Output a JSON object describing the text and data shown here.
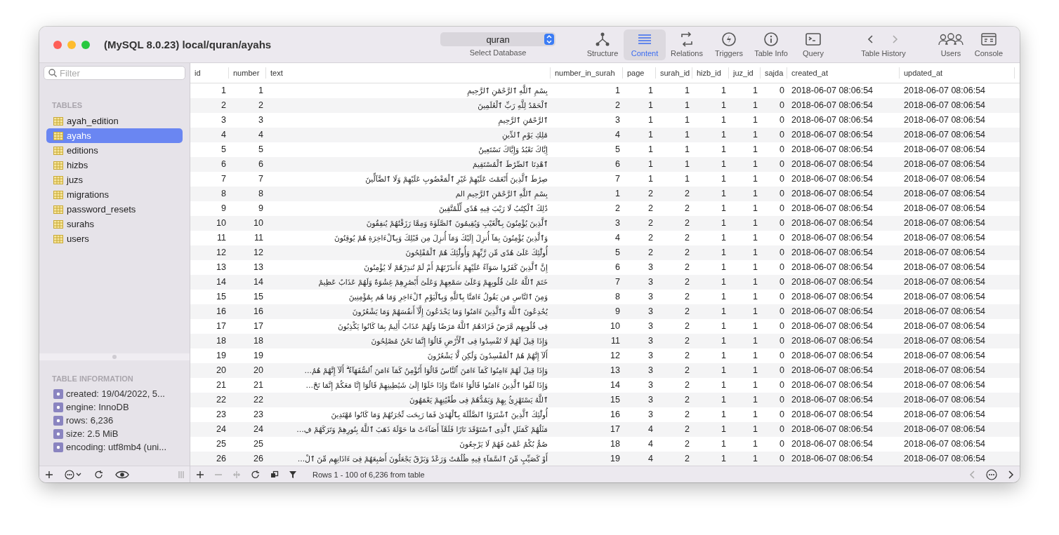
{
  "window": {
    "title": "(MySQL 8.0.23) local/quran/ayahs"
  },
  "database_selector": {
    "value": "quran",
    "label": "Select Database"
  },
  "toolbar": [
    {
      "kind": "structure",
      "label": "Structure",
      "selected": false
    },
    {
      "kind": "content",
      "label": "Content",
      "selected": true
    },
    {
      "kind": "relations",
      "label": "Relations",
      "selected": false
    },
    {
      "kind": "triggers",
      "label": "Triggers",
      "selected": false
    },
    {
      "kind": "info",
      "label": "Table Info",
      "selected": false
    },
    {
      "kind": "query",
      "label": "Query",
      "selected": false
    },
    {
      "kind": "history",
      "label": "Table History",
      "selected": false
    },
    {
      "kind": "users",
      "label": "Users",
      "selected": false
    },
    {
      "kind": "console",
      "label": "Console",
      "selected": false
    }
  ],
  "sidebar": {
    "filter_placeholder": "Filter",
    "tables_heading": "TABLES",
    "tables": [
      {
        "name": "ayah_edition",
        "selected": false
      },
      {
        "name": "ayahs",
        "selected": true
      },
      {
        "name": "editions",
        "selected": false
      },
      {
        "name": "hizbs",
        "selected": false
      },
      {
        "name": "juzs",
        "selected": false
      },
      {
        "name": "migrations",
        "selected": false
      },
      {
        "name": "password_resets",
        "selected": false
      },
      {
        "name": "surahs",
        "selected": false
      },
      {
        "name": "users",
        "selected": false
      }
    ],
    "info_heading": "TABLE INFORMATION",
    "info": [
      "created: 19/04/2022, 5...",
      "engine: InnoDB",
      "rows: 6,236",
      "size: 2.5 MiB",
      "encoding: utf8mb4 (uni..."
    ]
  },
  "table": {
    "columns": [
      "id",
      "number",
      "text",
      "number_in_surah",
      "page",
      "surah_id",
      "hizb_id",
      "juz_id",
      "sajda",
      "created_at",
      "updated_at"
    ],
    "rows": [
      [
        "1",
        "1",
        "بِسْمِ ٱللَّهِ ٱلرَّحْمَٰنِ ٱلرَّحِيمِ",
        "1",
        "1",
        "1",
        "1",
        "1",
        "0",
        "2018-06-07 08:06:54",
        "2018-06-07 08:06:54"
      ],
      [
        "2",
        "2",
        "ٱلْحَمْدُ لِلَّهِ رَبِّ ٱلْعَٰلَمِينَ",
        "2",
        "1",
        "1",
        "1",
        "1",
        "0",
        "2018-06-07 08:06:54",
        "2018-06-07 08:06:54"
      ],
      [
        "3",
        "3",
        "ٱلرَّحْمَٰنِ ٱلرَّحِيمِ",
        "3",
        "1",
        "1",
        "1",
        "1",
        "0",
        "2018-06-07 08:06:54",
        "2018-06-07 08:06:54"
      ],
      [
        "4",
        "4",
        "مَٰلِكِ يَوْمِ ٱلدِّينِ",
        "4",
        "1",
        "1",
        "1",
        "1",
        "0",
        "2018-06-07 08:06:54",
        "2018-06-07 08:06:54"
      ],
      [
        "5",
        "5",
        "إِيَّاكَ نَعْبُدُ وَإِيَّاكَ نَسْتَعِينُ",
        "5",
        "1",
        "1",
        "1",
        "1",
        "0",
        "2018-06-07 08:06:54",
        "2018-06-07 08:06:54"
      ],
      [
        "6",
        "6",
        "ٱهْدِنَا ٱلصِّرَٰطَ ٱلْمُسْتَقِيمَ",
        "6",
        "1",
        "1",
        "1",
        "1",
        "0",
        "2018-06-07 08:06:54",
        "2018-06-07 08:06:54"
      ],
      [
        "7",
        "7",
        "صِرَٰطَ ٱلَّذِينَ أَنْعَمْتَ عَلَيْهِمْ غَيْرِ ٱلْمَغْضُوبِ عَلَيْهِمْ وَلَا ٱلضَّآلِّينَ",
        "7",
        "1",
        "1",
        "1",
        "1",
        "0",
        "2018-06-07 08:06:54",
        "2018-06-07 08:06:54"
      ],
      [
        "8",
        "8",
        "بِسْمِ ٱللَّهِ ٱلرَّحْمَٰنِ ٱلرَّحِيمِ الم",
        "1",
        "2",
        "2",
        "1",
        "1",
        "0",
        "2018-06-07 08:06:54",
        "2018-06-07 08:06:54"
      ],
      [
        "9",
        "9",
        "ذَٰلِكَ ٱلْكِتَٰبُ لَا رَيْبَ فِيهِ هُدًى لِّلْمُتَّقِينَ",
        "2",
        "2",
        "2",
        "1",
        "1",
        "0",
        "2018-06-07 08:06:54",
        "2018-06-07 08:06:54"
      ],
      [
        "10",
        "10",
        "ٱلَّذِينَ يُؤْمِنُونَ بِٱلْغَيْبِ وَيُقِيمُونَ ٱلصَّلَوٰةَ وَمِمَّا رَزَقْنَٰهُمْ يُنفِقُونَ",
        "3",
        "2",
        "2",
        "1",
        "1",
        "0",
        "2018-06-07 08:06:54",
        "2018-06-07 08:06:54"
      ],
      [
        "11",
        "11",
        "وَٱلَّذِينَ يُؤْمِنُونَ بِمَآ أُنزِلَ إِلَيْكَ وَمَآ أُنزِلَ مِن قَبْلِكَ وَبِٱلْءَاخِرَةِ هُمْ يُوقِنُونَ",
        "4",
        "2",
        "2",
        "1",
        "1",
        "0",
        "2018-06-07 08:06:54",
        "2018-06-07 08:06:54"
      ],
      [
        "12",
        "12",
        "أُولَٰٓئِكَ عَلَىٰ هُدًى مِّن رَّبِّهِمْ وَأُولَٰٓئِكَ هُمُ ٱلْمُفْلِحُونَ",
        "5",
        "2",
        "2",
        "1",
        "1",
        "0",
        "2018-06-07 08:06:54",
        "2018-06-07 08:06:54"
      ],
      [
        "13",
        "13",
        "إِنَّ ٱلَّذِينَ كَفَرُوا سَوَآءٌ عَلَيْهِمْ ءَأَنذَرْتَهُمْ أَمْ لَمْ تُنذِرْهُمْ لَا يُؤْمِنُونَ",
        "6",
        "3",
        "2",
        "1",
        "1",
        "0",
        "2018-06-07 08:06:54",
        "2018-06-07 08:06:54"
      ],
      [
        "14",
        "14",
        "خَتَمَ ٱللَّهُ عَلَىٰ قُلُوبِهِمْ وَعَلَىٰ سَمْعِهِمْ وَعَلَىٰٓ أَبْصَٰرِهِمْ غِشَٰوَةٌ وَلَهُمْ عَذَابٌ عَظِيمٌ",
        "7",
        "3",
        "2",
        "1",
        "1",
        "0",
        "2018-06-07 08:06:54",
        "2018-06-07 08:06:54"
      ],
      [
        "15",
        "15",
        "وَمِنَ ٱلنَّاسِ مَن يَقُولُ ءَامَنَّا بِٱللَّهِ وَبِٱلْيَوْمِ ٱلْءَاخِرِ وَمَا هُم بِمُؤْمِنِينَ",
        "8",
        "3",
        "2",
        "1",
        "1",
        "0",
        "2018-06-07 08:06:54",
        "2018-06-07 08:06:54"
      ],
      [
        "16",
        "16",
        "يُخَٰدِعُونَ ٱللَّهَ وَٱلَّذِينَ ءَامَنُوا وَمَا يَخْدَعُونَ إِلَّآ أَنفُسَهُمْ وَمَا يَشْعُرُونَ",
        "9",
        "3",
        "2",
        "1",
        "1",
        "0",
        "2018-06-07 08:06:54",
        "2018-06-07 08:06:54"
      ],
      [
        "17",
        "17",
        "فِى قُلُوبِهِم مَّرَضٌ فَزَادَهُمُ ٱللَّهُ مَرَضًا وَلَهُمْ عَذَابٌ أَلِيمٌ بِمَا كَانُوا يَكْذِبُونَ",
        "10",
        "3",
        "2",
        "1",
        "1",
        "0",
        "2018-06-07 08:06:54",
        "2018-06-07 08:06:54"
      ],
      [
        "18",
        "18",
        "وَإِذَا قِيلَ لَهُمْ لَا تُفْسِدُوا فِى ٱلْأَرْضِ قَالُوٓا إِنَّمَا نَحْنُ مُصْلِحُونَ",
        "11",
        "3",
        "2",
        "1",
        "1",
        "0",
        "2018-06-07 08:06:54",
        "2018-06-07 08:06:54"
      ],
      [
        "19",
        "19",
        "أَلَآ إِنَّهُمْ هُمُ ٱلْمُفْسِدُونَ وَلَٰكِن لَّا يَشْعُرُونَ",
        "12",
        "3",
        "2",
        "1",
        "1",
        "0",
        "2018-06-07 08:06:54",
        "2018-06-07 08:06:54"
      ],
      [
        "20",
        "20",
        "وَإِذَا قِيلَ لَهُمْ ءَامِنُوا كَمَآ ءَامَنَ ٱلنَّاسُ قَالُوٓا أَنُؤْمِنُ كَمَآ ءَامَنَ ٱلسُّفَهَآءُ ۗ أَلَآ إِنَّهُمْ هُمُ…",
        "13",
        "3",
        "2",
        "1",
        "1",
        "0",
        "2018-06-07 08:06:54",
        "2018-06-07 08:06:54"
      ],
      [
        "21",
        "21",
        "وَإِذَا لَقُوا ٱلَّذِينَ ءَامَنُوا قَالُوٓا ءَامَنَّا وَإِذَا خَلَوْا إِلَىٰ شَيَٰطِينِهِمْ قَالُوٓا إِنَّا مَعَكُمْ إِنَّمَا نَحْ…",
        "14",
        "3",
        "2",
        "1",
        "1",
        "0",
        "2018-06-07 08:06:54",
        "2018-06-07 08:06:54"
      ],
      [
        "22",
        "22",
        "ٱللَّهُ يَسْتَهْزِئُ بِهِمْ وَيَمُدُّهُمْ فِى طُغْيَٰنِهِمْ يَعْمَهُونَ",
        "15",
        "3",
        "2",
        "1",
        "1",
        "0",
        "2018-06-07 08:06:54",
        "2018-06-07 08:06:54"
      ],
      [
        "23",
        "23",
        "أُولَٰٓئِكَ ٱلَّذِينَ ٱشْتَرَوُا ٱلضَّلَٰلَةَ بِٱلْهُدَىٰ فَمَا رَبِحَت تِّجَٰرَتُهُمْ وَمَا كَانُوا مُهْتَدِينَ",
        "16",
        "3",
        "2",
        "1",
        "1",
        "0",
        "2018-06-07 08:06:54",
        "2018-06-07 08:06:54"
      ],
      [
        "24",
        "24",
        "مَثَلُهُمْ كَمَثَلِ ٱلَّذِى ٱسْتَوْقَدَ نَارًا فَلَمَّآ أَضَآءَتْ مَا حَوْلَهُ ذَهَبَ ٱللَّهُ بِنُورِهِمْ وَتَرَكَهُمْ فِ…",
        "17",
        "4",
        "2",
        "1",
        "1",
        "0",
        "2018-06-07 08:06:54",
        "2018-06-07 08:06:54"
      ],
      [
        "25",
        "25",
        "صُمٌّ بُكْمٌ عُمْىٌ فَهُمْ لَا يَرْجِعُونَ",
        "18",
        "4",
        "2",
        "1",
        "1",
        "0",
        "2018-06-07 08:06:54",
        "2018-06-07 08:06:54"
      ],
      [
        "26",
        "26",
        "أَوْ كَصَيِّبٍ مِّنَ ٱلسَّمَآءِ فِيهِ ظُلُمَٰتٌ وَرَعْدٌ وَبَرْقٌ يَجْعَلُونَ أَصَٰبِعَهُمْ فِىٓ ءَاذَانِهِم مِّنَ ٱلْ…",
        "19",
        "4",
        "2",
        "1",
        "1",
        "0",
        "2018-06-07 08:06:54",
        "2018-06-07 08:06:54"
      ]
    ]
  },
  "status": "Rows 1 - 100 of 6,236 from table"
}
